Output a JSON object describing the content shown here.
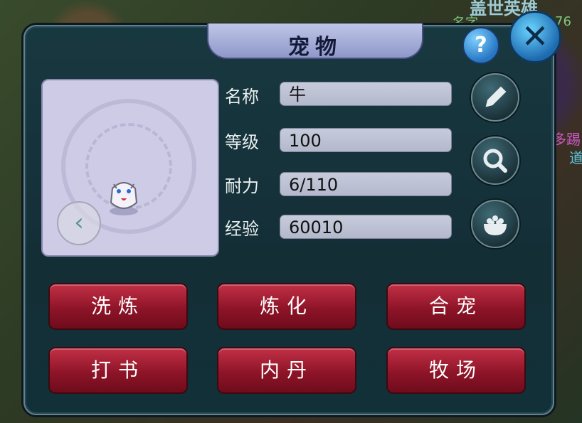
{
  "background": {
    "top_title": "盖世英雄",
    "top_sub": "名字",
    "top_num": "76",
    "right_text_1": "多踢",
    "right_text_2": "道"
  },
  "dialog": {
    "title": "宠物",
    "help_glyph": "?",
    "close_glyph": "✕",
    "prev_glyph": "‹"
  },
  "fields": [
    {
      "label": "名称",
      "value": "牛"
    },
    {
      "label": "等级",
      "value": "100"
    },
    {
      "label": "耐力",
      "value": "6/110"
    },
    {
      "label": "经验",
      "value": "60010"
    }
  ],
  "side_buttons": [
    {
      "icon": "pencil-icon"
    },
    {
      "icon": "magnifier-icon"
    },
    {
      "icon": "food-bowl-icon"
    }
  ],
  "actions": [
    {
      "label": "洗炼"
    },
    {
      "label": "炼化"
    },
    {
      "label": "合宠"
    },
    {
      "label": "打书"
    },
    {
      "label": "内丹"
    },
    {
      "label": "牧场"
    }
  ],
  "colors": {
    "panel": "#163640",
    "action_red": "#8e1428",
    "field_bg": "#c0c5d8",
    "preview_bg": "#cdcbe6"
  }
}
